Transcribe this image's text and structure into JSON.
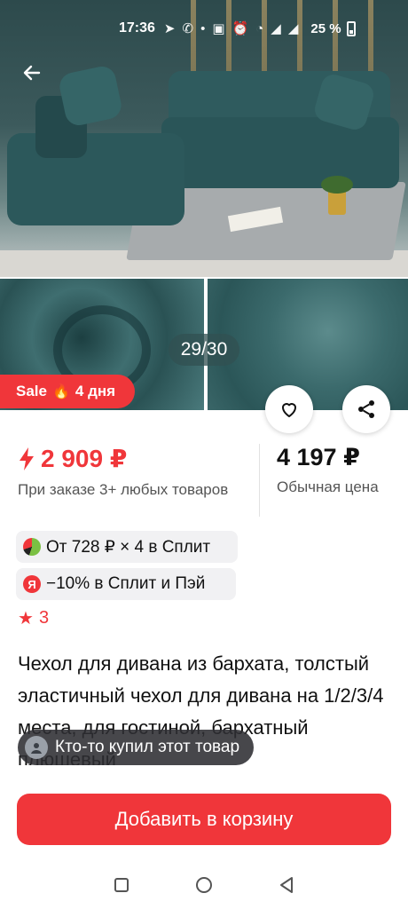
{
  "status_bar": {
    "time": "17:36",
    "battery": "25 %",
    "icons": [
      "telegram-icon",
      "whatsapp-icon",
      "dot-icon",
      "nfc-icon",
      "alarm-icon",
      "wifi-icon",
      "signal-icon",
      "signal-icon",
      "battery-icon"
    ]
  },
  "gallery": {
    "counter": "29/30",
    "sale_label": "Sale",
    "sale_days": "4 дня"
  },
  "price": {
    "current": "2 909 ₽",
    "current_note": "При заказе 3+ любых товаров",
    "regular": "4 197 ₽",
    "regular_note": "Обычная цена"
  },
  "promo": {
    "split": "От 728 ₽ × 4 в Сплит",
    "pay": "−10% в Сплит и Пэй"
  },
  "rating": {
    "value": "3"
  },
  "product": {
    "title": "Чехол для дивана из бархата, толстый эластичный чехол для дивана на 1/2/3/4 места, для гостиной, бархатный плюшевый"
  },
  "toast": {
    "text": "Кто-то купил этот товар"
  },
  "cta": {
    "add_to_cart": "Добавить в корзину"
  },
  "colors": {
    "accent": "#f0363a",
    "sofa": "#2c585b"
  }
}
